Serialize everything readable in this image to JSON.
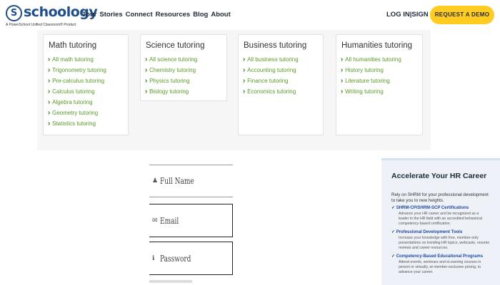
{
  "brand": {
    "name": "schoology",
    "mark": "S",
    "tagline": "A PowerSchool Unified Classroom® Product"
  },
  "nav": {
    "tour": "Tour",
    "stories": "Stories",
    "connect": "Connect",
    "resources": "Resources",
    "blog": "Blog",
    "about": "About"
  },
  "auth": {
    "login": "LOG IN",
    "separator": "|",
    "signup": "SIGN UP"
  },
  "cta": {
    "label": "REQUEST A DEMO"
  },
  "tutoring": [
    {
      "title": "Math tutoring",
      "links": [
        "All math tutoring",
        "Trigonometry tutoring",
        "Pre-calculus tutoring",
        "Calculus tutoring",
        "Algebra tutoring",
        "Geometry tutoring",
        "Statistics tutoring"
      ]
    },
    {
      "title": "Science tutoring",
      "links": [
        "All science tutoring",
        "Chemistry tutoring",
        "Physics tutoring",
        "Biology tutoring"
      ]
    },
    {
      "title": "Business tutoring",
      "links": [
        "All business tutoring",
        "Accounting tutoring",
        "Finance tutoring",
        "Economics tutoring"
      ]
    },
    {
      "title": "Humanities tutoring",
      "links": [
        "All humanities tutoring",
        "History tutoring",
        "Literature tutoring",
        "Writing tutoring"
      ]
    }
  ],
  "form": {
    "full_name": {
      "placeholder": "Full Name",
      "icon": "person-icon"
    },
    "email": {
      "placeholder": "Email",
      "icon": "envelope-icon"
    },
    "password": {
      "placeholder": "Password",
      "icon": "info-icon"
    }
  },
  "ad": {
    "title": "Accelerate Your HR Career",
    "intro": "Rely on SHRM for your professional development to take you to new heights.",
    "items": [
      {
        "title": "SHRM-CP/SHRM-SCP Certifications",
        "desc": "Advance your HR career and be recognized as a leader in the HR field with an accredited behavioral competency-based certification."
      },
      {
        "title": "Professional Development Tools",
        "desc": "Increase your knowledge with free, member-only presentations on trending HR topics, webcasts, resume reviews and career resources."
      },
      {
        "title": "Competency-Based Educational Programs",
        "desc": "Attend events, seminars and eLearning courses in person or virtually, at member-exclusive pricing, to advance your career."
      }
    ]
  }
}
